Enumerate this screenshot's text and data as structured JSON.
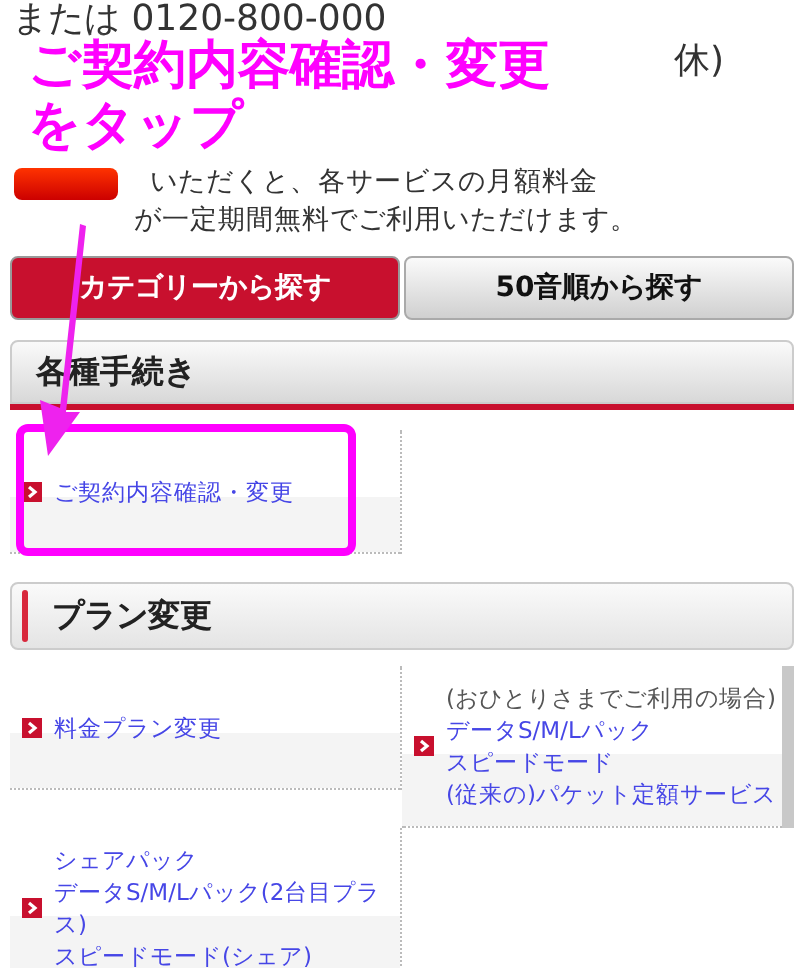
{
  "contact": {
    "phone_line": "または 0120-800-000",
    "hours_line_end": "休)"
  },
  "notice": {
    "lines": [
      "いただくと、各サービスの月額料金",
      "が一定期間無料でご利用いただけます。"
    ]
  },
  "tabs": [
    {
      "label": "カテゴリーから探す",
      "selected": true
    },
    {
      "label": "50音順から探す",
      "selected": false
    }
  ],
  "sections": [
    {
      "title": "各種手続き",
      "kind": "underline",
      "items": [
        {
          "lines": [
            "ご契約内容確認・変更"
          ]
        }
      ]
    },
    {
      "title": "プラン変更",
      "kind": "sidebar",
      "items": [
        {
          "lines": [
            "料金プラン変更"
          ]
        },
        {
          "note": "(おひとりさまでご利用の場合)",
          "lines": [
            "データS/M/Lパック",
            "スピードモード",
            "(従来の)パケット定額サービス"
          ]
        },
        {
          "lines": [
            "シェアパック",
            "データS/M/Lパック(2台目プラス)",
            "スピードモード(シェア)"
          ]
        }
      ]
    }
  ],
  "annotation": {
    "callout": [
      "ご契約内容確認・変更",
      "をタップ"
    ]
  }
}
